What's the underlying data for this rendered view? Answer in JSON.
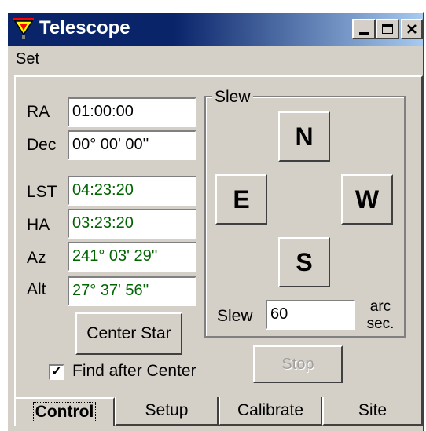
{
  "window": {
    "title": "Telescope",
    "icon": "telescope-app-icon"
  },
  "caption_buttons": {
    "minimize": "_",
    "maximize": "□",
    "close": "✕"
  },
  "menu": {
    "items": [
      "Set"
    ]
  },
  "coords": {
    "ra_label": "RA",
    "ra_value": "01:00:00",
    "dec_label": "Dec",
    "dec_value": "00° 00' 00''",
    "lst_label": "LST",
    "lst_value": "04:23:20",
    "ha_label": "HA",
    "ha_value": "03:23:20",
    "az_label": "Az",
    "az_value": "241° 03' 29''",
    "alt_label": "Alt",
    "alt_value": "27° 37' 56''"
  },
  "slew": {
    "group_title": "Slew",
    "north": "N",
    "east": "E",
    "west": "W",
    "south": "S",
    "rate_label": "Slew",
    "rate_value": "60",
    "unit_line1": "arc",
    "unit_line2": "sec."
  },
  "actions": {
    "center_star": "Center Star",
    "find_after_center": "Find after Center",
    "find_after_center_checked": true,
    "stop": "Stop"
  },
  "tabs": [
    "Control",
    "Setup",
    "Calibrate",
    "Site"
  ],
  "active_tab": "Control",
  "colors": {
    "title_bar": "#0a246a",
    "face": "#d4d0c8",
    "readout_text": "#006400"
  }
}
